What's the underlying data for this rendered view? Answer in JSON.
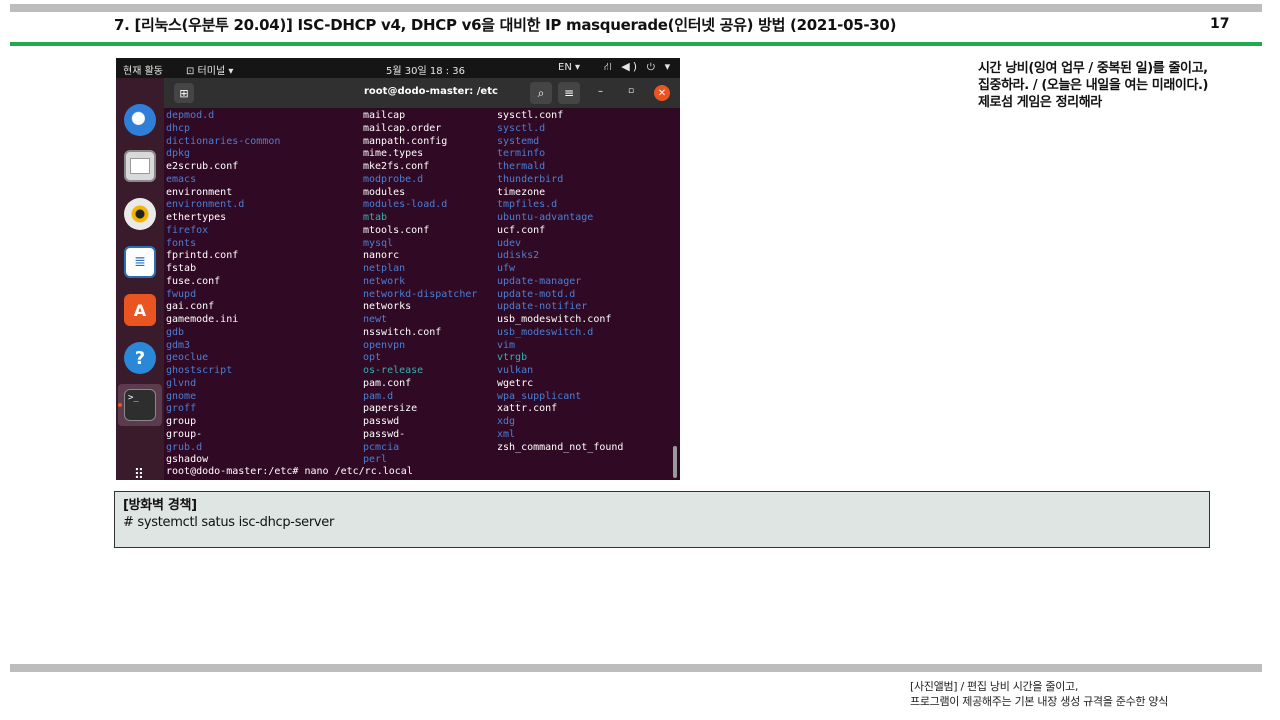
{
  "page": {
    "title": "7. [리눅스(우분투 20.04)] ISC-DHCP v4, DHCP v6을 대비한 IP masquerade(인터넷 공유) 방법 (2021-05-30)",
    "number": "17"
  },
  "side_note": {
    "line1": "시간 낭비(잉여 업무 / 중복된 일)를 줄이고,",
    "line2": "집중하라. / (오늘은 내일을 여는 미래이다.)",
    "line3": "제로섬 게임은 정리해라"
  },
  "gnome": {
    "activities": "현재 활동",
    "app_menu": "⊡ 터미널 ▾",
    "clock": "5월 30일  18 : 36",
    "lang": "EN ▾",
    "tray": "⛙ ◀) ⏻ ▾"
  },
  "terminal": {
    "title": "root@dodo-master: /etc",
    "new_tab": "⊞",
    "search": "⌕",
    "menu": "≡",
    "minimize": "–",
    "maximize": "▫",
    "close": "✕",
    "col1": [
      {
        "t": "depmod.d",
        "k": "dir"
      },
      {
        "t": "dhcp",
        "k": "dir"
      },
      {
        "t": "dictionaries-common",
        "k": "dir"
      },
      {
        "t": "dpkg",
        "k": "dir"
      },
      {
        "t": "e2scrub.conf",
        "k": "file"
      },
      {
        "t": "emacs",
        "k": "dir"
      },
      {
        "t": "environment",
        "k": "file"
      },
      {
        "t": "environment.d",
        "k": "dir"
      },
      {
        "t": "ethertypes",
        "k": "file"
      },
      {
        "t": "firefox",
        "k": "dir"
      },
      {
        "t": "fonts",
        "k": "dir"
      },
      {
        "t": "fprintd.conf",
        "k": "file"
      },
      {
        "t": "fstab",
        "k": "file"
      },
      {
        "t": "fuse.conf",
        "k": "file"
      },
      {
        "t": "fwupd",
        "k": "dir"
      },
      {
        "t": "gai.conf",
        "k": "file"
      },
      {
        "t": "gamemode.ini",
        "k": "file"
      },
      {
        "t": "gdb",
        "k": "dir"
      },
      {
        "t": "gdm3",
        "k": "dir"
      },
      {
        "t": "geoclue",
        "k": "dir"
      },
      {
        "t": "ghostscript",
        "k": "dir"
      },
      {
        "t": "glvnd",
        "k": "dir"
      },
      {
        "t": "gnome",
        "k": "dir"
      },
      {
        "t": "groff",
        "k": "dir"
      },
      {
        "t": "group",
        "k": "file"
      },
      {
        "t": "group-",
        "k": "file"
      },
      {
        "t": "grub.d",
        "k": "dir"
      },
      {
        "t": "gshadow",
        "k": "file"
      }
    ],
    "col2": [
      {
        "t": "mailcap",
        "k": "file"
      },
      {
        "t": "mailcap.order",
        "k": "file"
      },
      {
        "t": "manpath.config",
        "k": "file"
      },
      {
        "t": "mime.types",
        "k": "file"
      },
      {
        "t": "mke2fs.conf",
        "k": "file"
      },
      {
        "t": "modprobe.d",
        "k": "dir"
      },
      {
        "t": "modules",
        "k": "file"
      },
      {
        "t": "modules-load.d",
        "k": "dir"
      },
      {
        "t": "mtab",
        "k": "cyan"
      },
      {
        "t": "mtools.conf",
        "k": "file"
      },
      {
        "t": "mysql",
        "k": "dir"
      },
      {
        "t": "nanorc",
        "k": "file"
      },
      {
        "t": "netplan",
        "k": "dir"
      },
      {
        "t": "network",
        "k": "dir"
      },
      {
        "t": "networkd-dispatcher",
        "k": "dir"
      },
      {
        "t": "networks",
        "k": "file"
      },
      {
        "t": "newt",
        "k": "dir"
      },
      {
        "t": "nsswitch.conf",
        "k": "file"
      },
      {
        "t": "openvpn",
        "k": "dir"
      },
      {
        "t": "opt",
        "k": "dir"
      },
      {
        "t": "os-release",
        "k": "cyan"
      },
      {
        "t": "pam.conf",
        "k": "file"
      },
      {
        "t": "pam.d",
        "k": "dir"
      },
      {
        "t": "papersize",
        "k": "file"
      },
      {
        "t": "passwd",
        "k": "file"
      },
      {
        "t": "passwd-",
        "k": "file"
      },
      {
        "t": "pcmcia",
        "k": "dir"
      },
      {
        "t": "perl",
        "k": "dir"
      }
    ],
    "col3": [
      {
        "t": "sysctl.conf",
        "k": "file"
      },
      {
        "t": "sysctl.d",
        "k": "dir"
      },
      {
        "t": "systemd",
        "k": "dir"
      },
      {
        "t": "terminfo",
        "k": "dir"
      },
      {
        "t": "thermald",
        "k": "dir"
      },
      {
        "t": "thunderbird",
        "k": "dir"
      },
      {
        "t": "timezone",
        "k": "file"
      },
      {
        "t": "tmpfiles.d",
        "k": "dir"
      },
      {
        "t": "ubuntu-advantage",
        "k": "dir"
      },
      {
        "t": "ucf.conf",
        "k": "file"
      },
      {
        "t": "udev",
        "k": "dir"
      },
      {
        "t": "udisks2",
        "k": "dir"
      },
      {
        "t": "ufw",
        "k": "dir"
      },
      {
        "t": "update-manager",
        "k": "dir"
      },
      {
        "t": "update-motd.d",
        "k": "dir"
      },
      {
        "t": "update-notifier",
        "k": "dir"
      },
      {
        "t": "usb_modeswitch.conf",
        "k": "file"
      },
      {
        "t": "usb_modeswitch.d",
        "k": "dir"
      },
      {
        "t": "vim",
        "k": "dir"
      },
      {
        "t": "vtrgb",
        "k": "cyan"
      },
      {
        "t": "vulkan",
        "k": "dir"
      },
      {
        "t": "wgetrc",
        "k": "file"
      },
      {
        "t": "wpa_supplicant",
        "k": "dir"
      },
      {
        "t": "xattr.conf",
        "k": "file"
      },
      {
        "t": "xdg",
        "k": "dir"
      },
      {
        "t": "xml",
        "k": "dir"
      },
      {
        "t": "zsh_command_not_found",
        "k": "file"
      }
    ],
    "prompt": "root@dodo-master:/etc# nano /etc/rc.local"
  },
  "dock": {
    "writer_glyph": "≣",
    "store_glyph": "A",
    "help_glyph": "?",
    "terminal_glyph": ">_",
    "apps_glyph": "⠿"
  },
  "firewall_box": {
    "title": "[방화벽 경책]",
    "command": "# systemctl satus isc-dhcp-server"
  },
  "footer": {
    "line1": "[사진앨범] / 편집 낭비 시간을 줄이고,",
    "line2": "프로그램이 제공해주는 기본 내장 생성 규격을 준수한 양식"
  },
  "colors": {
    "accent_green": "#1faa4f",
    "terminal_bg": "#300a24",
    "dir_blue": "#4a7fd6",
    "link_cyan": "#2fb2b2",
    "ubuntu_orange": "#e95420"
  }
}
